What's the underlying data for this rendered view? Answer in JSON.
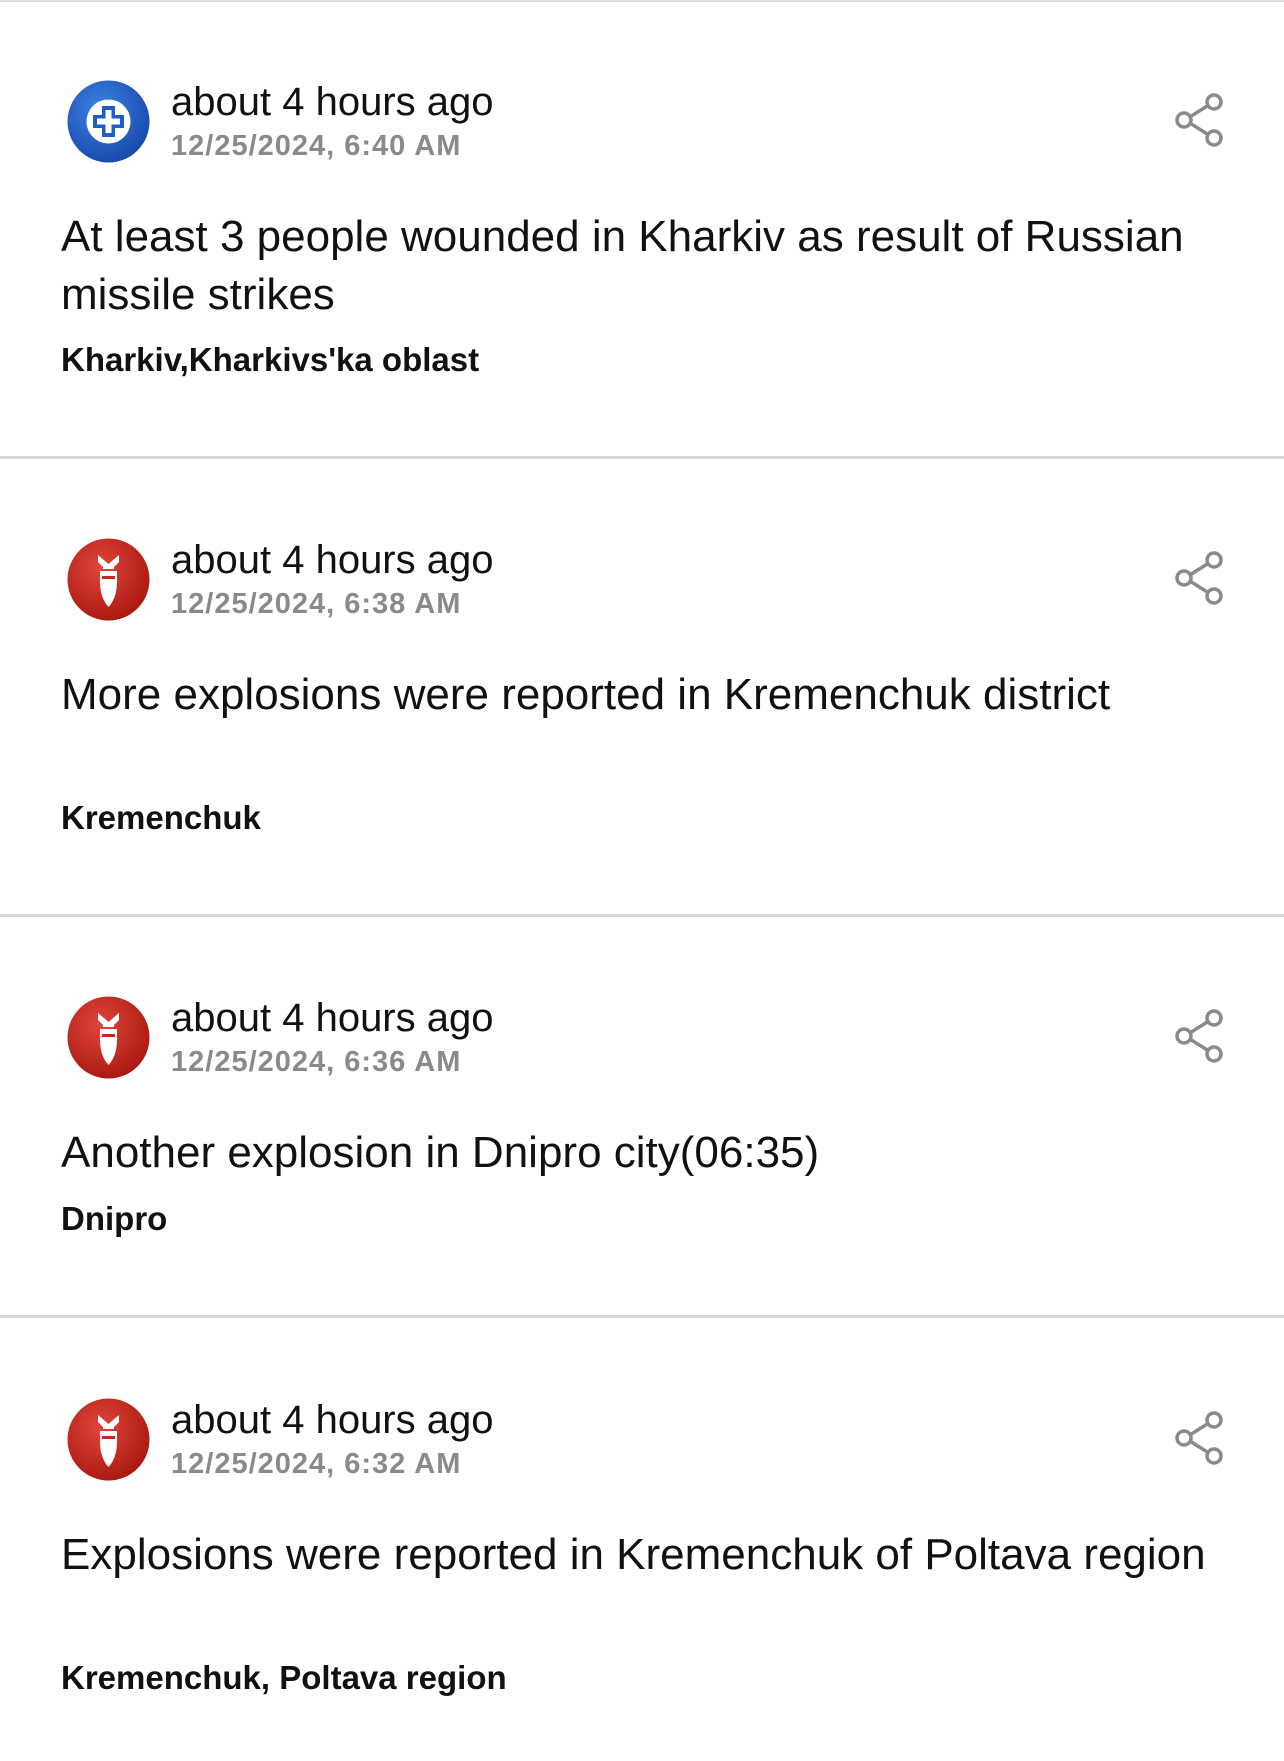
{
  "feed": {
    "items": [
      {
        "category_icon": "medical-cross-icon",
        "category_color": "#1c5fc4",
        "time_ago": "about 4 hours ago",
        "timestamp": "12/25/2024, 6:40 AM",
        "headline": "At least 3 people wounded in Kharkiv as result of Russian missile strikes",
        "location": "Kharkiv,Kharkivs'ka oblast"
      },
      {
        "category_icon": "bomb-icon",
        "category_color": "#c7271f",
        "time_ago": "about 4 hours ago",
        "timestamp": "12/25/2024, 6:38 AM",
        "headline": "More explosions were reported in Kremenchuk district",
        "location": "Kremenchuk"
      },
      {
        "category_icon": "bomb-icon",
        "category_color": "#c7271f",
        "time_ago": "about 4 hours ago",
        "timestamp": "12/25/2024, 6:36 AM",
        "headline": "Another explosion in Dnipro city(06:35)",
        "location": "Dnipro"
      },
      {
        "category_icon": "bomb-icon",
        "category_color": "#c7271f",
        "time_ago": "about 4 hours ago",
        "timestamp": "12/25/2024, 6:32 AM",
        "headline": "Explosions were reported in Kremenchuk of Poltava region",
        "location": "Kremenchuk, Poltava region"
      }
    ],
    "share_icon": "share-icon"
  }
}
